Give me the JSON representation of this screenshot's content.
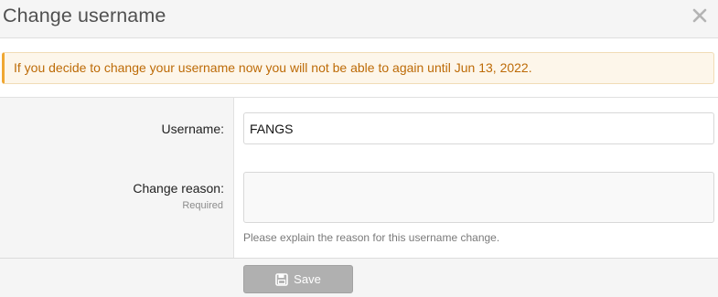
{
  "dialog": {
    "title": "Change username",
    "close_icon": "close-icon"
  },
  "notice": {
    "text": "If you decide to change your username now you will not be able to again until Jun 13, 2022.",
    "accent_color": "#f0a732",
    "text_color": "#bd6b07"
  },
  "form": {
    "username_label": "Username:",
    "username_value": "FANGS",
    "reason_label": "Change reason:",
    "reason_required": "Required",
    "reason_value": "",
    "reason_explain": "Please explain the reason for this username change."
  },
  "footer": {
    "save_label": "Save",
    "save_icon": "save-icon"
  }
}
